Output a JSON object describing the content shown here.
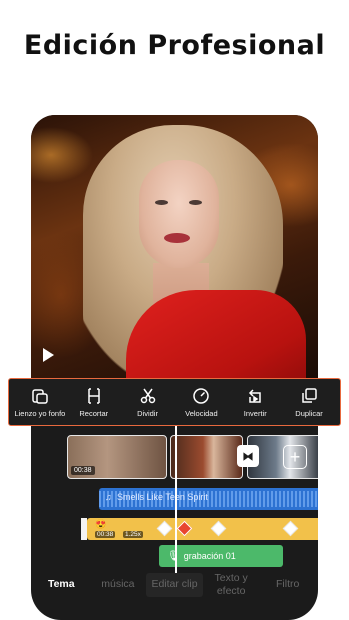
{
  "headline": "Edición Profesional",
  "toolbar": {
    "items": [
      {
        "label": "Lienzo yo fonfo",
        "icon": "canvas-icon"
      },
      {
        "label": "Recortar",
        "icon": "trim-icon"
      },
      {
        "label": "Dividir",
        "icon": "scissors-icon"
      },
      {
        "label": "Velocidad",
        "icon": "speedometer-icon"
      },
      {
        "label": "Invertir",
        "icon": "reverse-icon"
      },
      {
        "label": "Duplicar",
        "icon": "duplicate-icon"
      }
    ],
    "border_color": "#e8693e"
  },
  "timeline": {
    "clips": [
      {
        "duration": "00:38"
      },
      {
        "duration": ""
      },
      {
        "duration": ""
      }
    ],
    "audio": {
      "title": "Smells Like Teen Spirit"
    },
    "effect": {
      "badge": "😍",
      "duration": "00:38",
      "speed": "1.25x"
    },
    "clip_speed": "1.25x",
    "voiceover": {
      "label": "grabación 01"
    },
    "colors": {
      "audio": "#2d72d2",
      "effect": "#f2c14a",
      "voiceover": "#4cb96a",
      "keyframe_active": "#e8452f"
    }
  },
  "tabs": [
    {
      "label": "Tema",
      "active": true
    },
    {
      "label": "música",
      "active": false
    },
    {
      "label": "Editar clip",
      "active": false
    },
    {
      "label": "Texto y efecto",
      "active": false
    },
    {
      "label": "Filtro",
      "active": false
    }
  ]
}
